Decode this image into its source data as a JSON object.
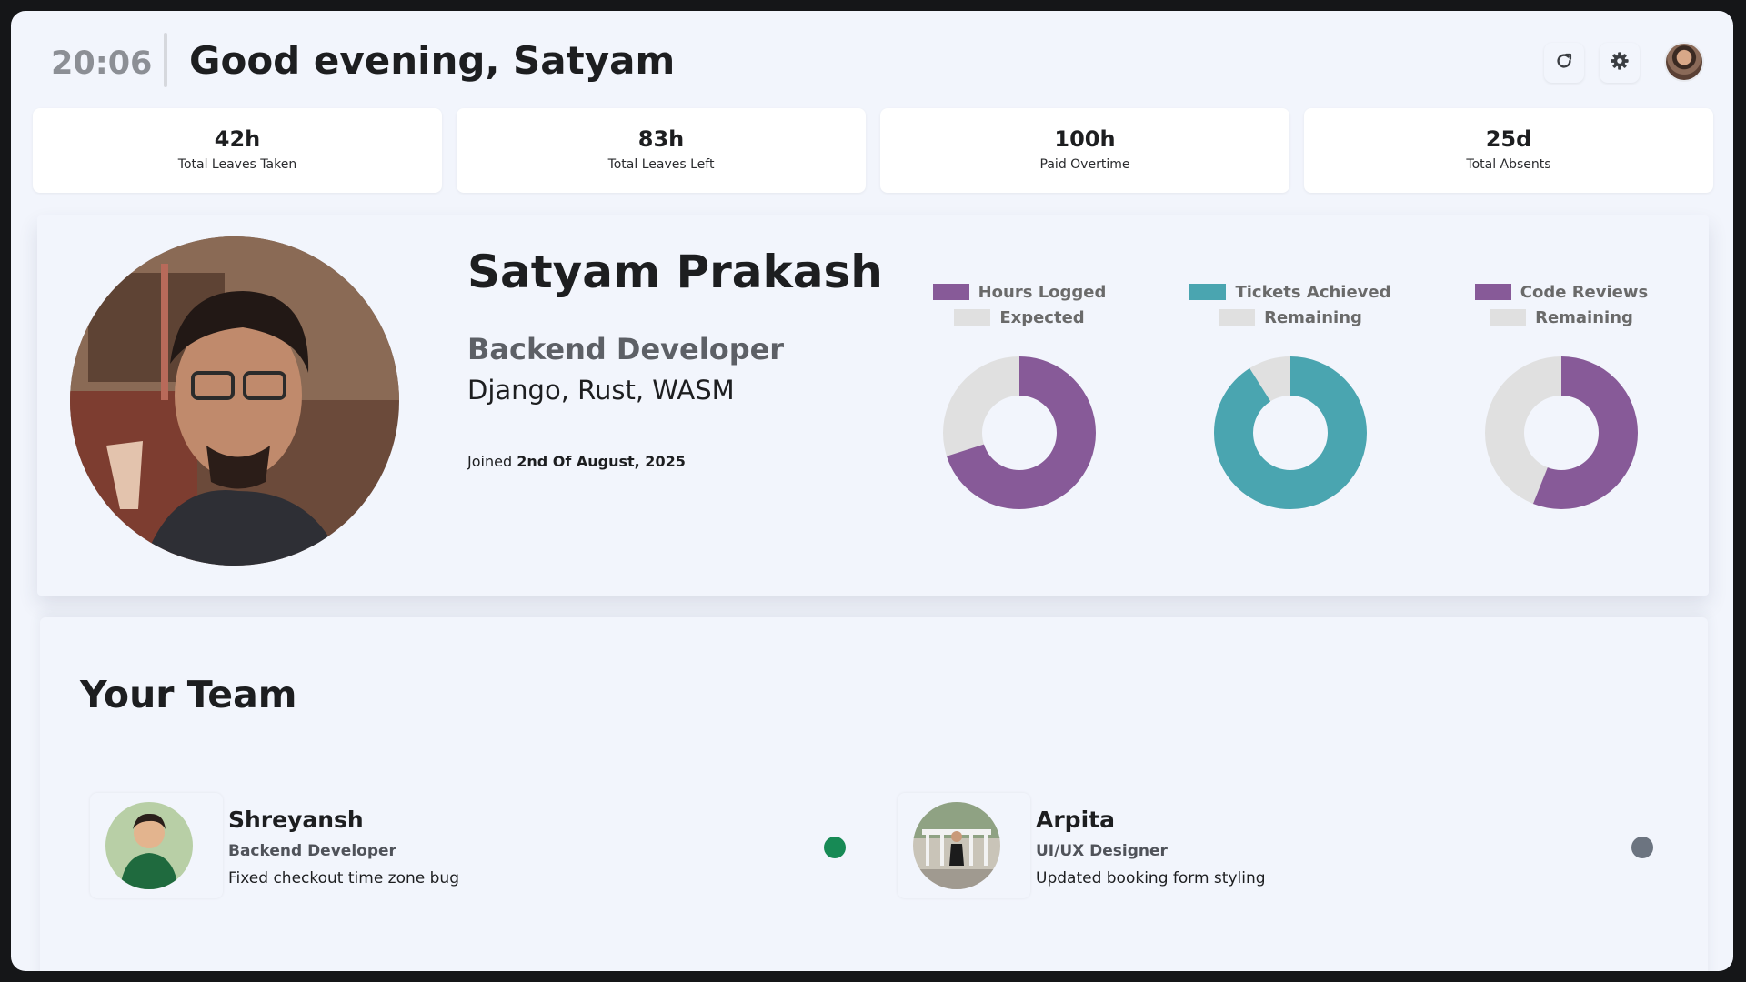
{
  "header": {
    "time": "20:06",
    "greeting": "Good evening, Satyam",
    "icons": [
      "refresh-icon",
      "gear-icon"
    ]
  },
  "stats": [
    {
      "value": "42h",
      "label": "Total Leaves Taken"
    },
    {
      "value": "83h",
      "label": "Total Leaves Left"
    },
    {
      "value": "100h",
      "label": "Paid Overtime"
    },
    {
      "value": "25d",
      "label": "Total Absents"
    }
  ],
  "profile": {
    "name": "Satyam Prakash",
    "role": "Backend Developer",
    "skills": "Django, Rust, WASM",
    "joined_prefix": "Joined",
    "joined_date": "2nd Of August, 2025"
  },
  "charts": [
    {
      "legend": [
        "Hours Logged",
        "Expected"
      ],
      "colors": [
        "#875a98",
        "#e0e0e0"
      ],
      "primary_fraction": 0.7
    },
    {
      "legend": [
        "Tickets Achieved",
        "Remaining"
      ],
      "colors": [
        "#4aa5b0",
        "#e0e0e0"
      ],
      "primary_fraction": 0.91
    },
    {
      "legend": [
        "Code Reviews",
        "Remaining"
      ],
      "colors": [
        "#875a98",
        "#e0e0e0"
      ],
      "primary_fraction": 0.56
    }
  ],
  "team": {
    "title": "Your Team",
    "members": [
      {
        "name": "Shreyansh",
        "role": "Backend Developer",
        "status": "Fixed checkout time zone bug",
        "dot_color": "#178a55"
      },
      {
        "name": "Arpita",
        "role": "UI/UX Designer",
        "status": "Updated booking form styling",
        "dot_color": "#6c7480"
      }
    ]
  }
}
